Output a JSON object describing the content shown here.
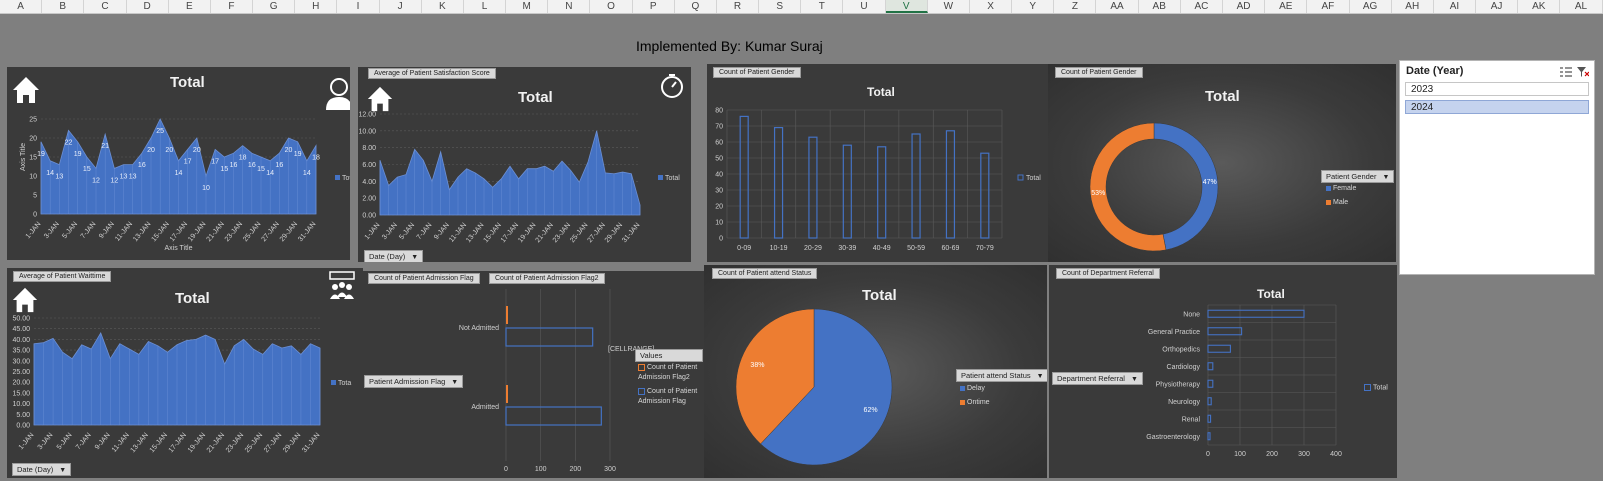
{
  "columns": [
    "A",
    "B",
    "C",
    "D",
    "E",
    "F",
    "G",
    "H",
    "I",
    "J",
    "K",
    "L",
    "M",
    "N",
    "O",
    "P",
    "Q",
    "R",
    "S",
    "T",
    "U",
    "V",
    "W",
    "X",
    "Y",
    "Z",
    "AA",
    "AB",
    "AC",
    "AD",
    "AE",
    "AF",
    "AG",
    "AH",
    "AI",
    "AJ",
    "AK",
    "AL"
  ],
  "selected_column": "V",
  "page_title": "Implemented By: Kumar Suraj",
  "slicer": {
    "title": "Date (Year)",
    "items": [
      "2023",
      "2024"
    ],
    "selected": "2024"
  },
  "colors": {
    "blue": "#4472c4",
    "orange": "#ed7d31",
    "panel": "#3a3a3a"
  },
  "panels": {
    "p1": {
      "title": "Total",
      "ylabel": "Axis Title",
      "xlabel": "Axis Title",
      "legend": "Tot",
      "icons": [
        "home-icon",
        "user-icon"
      ]
    },
    "p2": {
      "tag": "Average of Patient Satisfaction Score",
      "title": "Total",
      "legend": "Total",
      "filter": "Date (Day)",
      "icons": [
        "home-icon",
        "timer-icon"
      ]
    },
    "p3": {
      "tag": "Count of Patient Gender",
      "title": "Total",
      "legend": "Total"
    },
    "p4": {
      "tag": "Count of Patient Gender",
      "title": "Total",
      "filter": "Patient Gender",
      "legend": [
        "Female",
        "Male"
      ],
      "pct": [
        "47%",
        "53%"
      ]
    },
    "p5": {
      "tag": "Average of Patient Waittime",
      "title": "Total",
      "legend": "Tota",
      "filter": "Date (Day)",
      "icons": [
        "home-icon",
        "group-icon"
      ]
    },
    "p6": {
      "tags": [
        "Count of Patient Admission Flag",
        "Count of Patient Admission Flag2"
      ],
      "filter": "Patient Admission Flag",
      "values_label": "Values",
      "cellrange": "[CELLRANGE]",
      "legend": [
        "Count of Patient Admission Flag2",
        "Count of Patient Admission Flag"
      ]
    },
    "p7": {
      "tag": "Count of Patient attend Status",
      "title": "Total",
      "filter": "Patient attend Status",
      "legend": [
        "Delay",
        "Ontime"
      ],
      "pct": [
        "62%",
        "38%"
      ]
    },
    "p8": {
      "tag": "Count of Department Referral",
      "title": "Total",
      "filter": "Department Referral",
      "legend": "Total"
    }
  },
  "chart_data": [
    {
      "type": "area",
      "title": "Total",
      "xlabel": "Axis Title",
      "ylabel": "Axis Title",
      "x": [
        "1-JAN",
        "2-JAN",
        "3-JAN",
        "4-JAN",
        "5-JAN",
        "6-JAN",
        "7-JAN",
        "8-JAN",
        "9-JAN",
        "10-JAN",
        "11-JAN",
        "12-JAN",
        "13-JAN",
        "14-JAN",
        "15-JAN",
        "16-JAN",
        "17-JAN",
        "18-JAN",
        "19-JAN",
        "20-JAN",
        "21-JAN",
        "22-JAN",
        "23-JAN",
        "24-JAN",
        "25-JAN",
        "26-JAN",
        "27-JAN",
        "28-JAN",
        "29-JAN",
        "30-JAN",
        "31-JAN"
      ],
      "xticks": [
        "1-JAN",
        "3-JAN",
        "5-JAN",
        "7-JAN",
        "9-JAN",
        "11-JAN",
        "13-JAN",
        "15-JAN",
        "17-JAN",
        "19-JAN",
        "21-JAN",
        "23-JAN",
        "25-JAN",
        "27-JAN",
        "29-JAN",
        "31-JAN"
      ],
      "values": [
        19,
        14,
        13,
        22,
        19,
        15,
        12,
        21,
        12,
        13,
        13,
        16,
        20,
        25,
        20,
        14,
        17,
        20,
        10,
        17,
        15,
        16,
        18,
        16,
        15,
        14,
        16,
        20,
        19,
        14,
        18
      ],
      "yticks": [
        0,
        5,
        10,
        15,
        20,
        25
      ],
      "ylim": [
        0,
        30
      ],
      "legend": "Tot"
    },
    {
      "type": "area",
      "title": "Total",
      "ylabel": "Average of Patient Satisfaction Score",
      "x_count": 31,
      "xticks": [
        "1-JAN",
        "3-JAN",
        "5-JAN",
        "7-JAN",
        "9-JAN",
        "11-JAN",
        "13-JAN",
        "15-JAN",
        "17-JAN",
        "19-JAN",
        "21-JAN",
        "23-JAN",
        "25-JAN",
        "27-JAN",
        "29-JAN",
        "31-JAN"
      ],
      "values": [
        6.5,
        3.5,
        4.5,
        4.8,
        7.8,
        6.5,
        4,
        7.5,
        3,
        4.5,
        5.5,
        5,
        4.3,
        3.3,
        4.3,
        5.8,
        4.3,
        5.5,
        5.5,
        5.8,
        5.2,
        6.4,
        5.3,
        3.9,
        6.3,
        10,
        5,
        4.9,
        5.1,
        4.9,
        1.2
      ],
      "yticks": [
        "0.00",
        "2.00",
        "4.00",
        "6.00",
        "8.00",
        "10.00",
        "12.00"
      ],
      "ylim": [
        0,
        12
      ],
      "legend": "Total"
    },
    {
      "type": "bar",
      "title": "Total",
      "categories": [
        "0-09",
        "10-19",
        "20-29",
        "30-39",
        "40-49",
        "50-59",
        "60-69",
        "70-79"
      ],
      "values": [
        76,
        69,
        63,
        58,
        57,
        65,
        67,
        53
      ],
      "yticks": [
        0,
        10,
        20,
        30,
        40,
        50,
        60,
        70,
        80
      ],
      "ylim": [
        0,
        80
      ],
      "legend": "Total"
    },
    {
      "type": "pie",
      "title": "Total",
      "subtype": "donut",
      "categories": [
        "Female",
        "Male"
      ],
      "values": [
        47,
        53
      ],
      "labels": [
        "47%",
        "53%"
      ]
    },
    {
      "type": "area",
      "title": "Total",
      "ylabel": "Average of Patient Waittime",
      "x_count": 31,
      "xticks": [
        "1-JAN",
        "3-JAN",
        "5-JAN",
        "7-JAN",
        "9-JAN",
        "11-JAN",
        "13-JAN",
        "15-JAN",
        "17-JAN",
        "19-JAN",
        "21-JAN",
        "23-JAN",
        "25-JAN",
        "27-JAN",
        "29-JAN",
        "31-JAN"
      ],
      "values": [
        38,
        38.5,
        40.5,
        34,
        31,
        37.5,
        35.5,
        43,
        31,
        38,
        35.5,
        33,
        39,
        37,
        34,
        37.5,
        39.5,
        40,
        42,
        40,
        28.5,
        37,
        40,
        35.5,
        33,
        38,
        36,
        37,
        33,
        38,
        36
      ],
      "yticks": [
        "0.00",
        "5.00",
        "10.00",
        "15.00",
        "20.00",
        "25.00",
        "30.00",
        "35.00",
        "40.00",
        "45.00",
        "50.00"
      ],
      "ylim": [
        0,
        50
      ],
      "legend": "Tota"
    },
    {
      "type": "bar",
      "orientation": "horizontal",
      "categories": [
        "Not Admitted",
        "Admitted"
      ],
      "series": [
        {
          "name": "Count of Patient Admission Flag2",
          "values": [
            0,
            0
          ]
        },
        {
          "name": "Count of Patient Admission Flag",
          "values": [
            250,
            275
          ]
        }
      ],
      "xticks": [
        0,
        100,
        200,
        300
      ],
      "xlim": [
        0,
        300
      ]
    },
    {
      "type": "pie",
      "title": "Total",
      "categories": [
        "Delay",
        "Ontime"
      ],
      "values": [
        62,
        38
      ],
      "labels": [
        "62%",
        "38%"
      ]
    },
    {
      "type": "bar",
      "orientation": "horizontal",
      "title": "Total",
      "categories": [
        "None",
        "General Practice",
        "Orthopedics",
        "Cardiology",
        "Physiotherapy",
        "Neurology",
        "Renal",
        "Gastroenterology"
      ],
      "values": [
        300,
        105,
        70,
        15,
        15,
        10,
        8,
        6
      ],
      "xticks": [
        0,
        100,
        200,
        300,
        400
      ],
      "xlim": [
        0,
        400
      ],
      "legend": "Total"
    }
  ]
}
